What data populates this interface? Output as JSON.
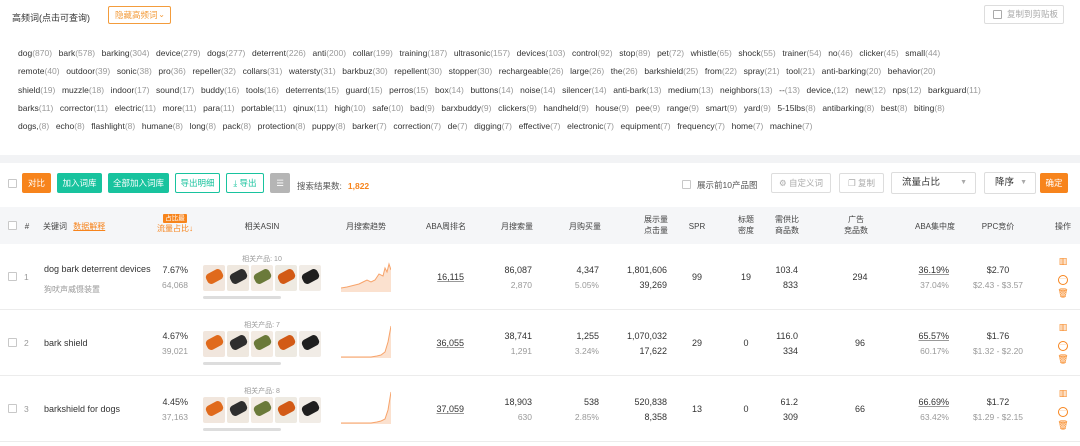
{
  "header": {
    "title": "高频词(点击可查询)",
    "hide_btn": "隐藏高频词",
    "copy_btn": "复制到剪贴板"
  },
  "keyword_lines": [
    [
      [
        "dog",
        "870"
      ],
      [
        "bark",
        "578"
      ],
      [
        "barking",
        "304"
      ],
      [
        "device",
        "279"
      ],
      [
        "dogs",
        "277"
      ],
      [
        "deterrent",
        "226"
      ],
      [
        "anti",
        "200"
      ],
      [
        "collar",
        "199"
      ],
      [
        "training",
        "187"
      ],
      [
        "ultrasonic",
        "157"
      ],
      [
        "devices",
        "103"
      ],
      [
        "control",
        "92"
      ],
      [
        "stop",
        "89"
      ],
      [
        "pet",
        "72"
      ],
      [
        "whistle",
        "65"
      ],
      [
        "shock",
        "55"
      ],
      [
        "trainer",
        "54"
      ],
      [
        "no",
        "46"
      ],
      [
        "clicker",
        "45"
      ],
      [
        "small",
        "44"
      ]
    ],
    [
      [
        "remote",
        "40"
      ],
      [
        "outdoor",
        "39"
      ],
      [
        "sonic",
        "38"
      ],
      [
        "pro",
        "36"
      ],
      [
        "repeller",
        "32"
      ],
      [
        "collars",
        "31"
      ],
      [
        "watersty",
        "31"
      ],
      [
        "barkbuz",
        "30"
      ],
      [
        "repellent",
        "30"
      ],
      [
        "stopper",
        "30"
      ],
      [
        "rechargeable",
        "26"
      ],
      [
        "large",
        "26"
      ],
      [
        "the",
        "26"
      ],
      [
        "barkshield",
        "25"
      ],
      [
        "from",
        "22"
      ],
      [
        "spray",
        "21"
      ],
      [
        "tool",
        "21"
      ],
      [
        "anti-barking",
        "20"
      ],
      [
        "behavior",
        "20"
      ]
    ],
    [
      [
        "shield",
        "19"
      ],
      [
        "muzzle",
        "18"
      ],
      [
        "indoor",
        "17"
      ],
      [
        "sound",
        "17"
      ],
      [
        "buddy",
        "16"
      ],
      [
        "tools",
        "16"
      ],
      [
        "deterrents",
        "15"
      ],
      [
        "guard",
        "15"
      ],
      [
        "perros",
        "15"
      ],
      [
        "box",
        "14"
      ],
      [
        "buttons",
        "14"
      ],
      [
        "noise",
        "14"
      ],
      [
        "silencer",
        "14"
      ],
      [
        "anti-bark",
        "13"
      ],
      [
        "medium",
        "13"
      ],
      [
        "neighbors",
        "13"
      ],
      [
        "--",
        "13"
      ],
      [
        "device,",
        "12"
      ],
      [
        "new",
        "12"
      ],
      [
        "nps",
        "12"
      ],
      [
        "barkguard",
        "11"
      ]
    ],
    [
      [
        "barks",
        "11"
      ],
      [
        "corrector",
        "11"
      ],
      [
        "electric",
        "11"
      ],
      [
        "more",
        "11"
      ],
      [
        "para",
        "11"
      ],
      [
        "portable",
        "11"
      ],
      [
        "qinux",
        "11"
      ],
      [
        "high",
        "10"
      ],
      [
        "safe",
        "10"
      ],
      [
        "bad",
        "9"
      ],
      [
        "barxbuddy",
        "9"
      ],
      [
        "clickers",
        "9"
      ],
      [
        "handheld",
        "9"
      ],
      [
        "house",
        "9"
      ],
      [
        "pee",
        "9"
      ],
      [
        "range",
        "9"
      ],
      [
        "smart",
        "9"
      ],
      [
        "yard",
        "9"
      ],
      [
        "5-15lbs",
        "8"
      ],
      [
        "antibarking",
        "8"
      ],
      [
        "best",
        "8"
      ],
      [
        "biting",
        "8"
      ]
    ],
    [
      [
        "dogs,",
        "8"
      ],
      [
        "echo",
        "8"
      ],
      [
        "flashlight",
        "8"
      ],
      [
        "humane",
        "8"
      ],
      [
        "long",
        "8"
      ],
      [
        "pack",
        "8"
      ],
      [
        "protection",
        "8"
      ],
      [
        "puppy",
        "8"
      ],
      [
        "barker",
        "7"
      ],
      [
        "correction",
        "7"
      ],
      [
        "de",
        "7"
      ],
      [
        "digging",
        "7"
      ],
      [
        "effective",
        "7"
      ],
      [
        "electronic",
        "7"
      ],
      [
        "equipment",
        "7"
      ],
      [
        "frequency",
        "7"
      ],
      [
        "home",
        "7"
      ],
      [
        "machine",
        "7"
      ]
    ]
  ],
  "toolbar": {
    "compare": "对比",
    "add_lib": "加入词库",
    "add_all": "全部加入词库",
    "export_detail": "导出明细",
    "export": "导出",
    "search_label": "搜索结果数:",
    "search_count": "1,822",
    "show_top10": "展示前10产品图",
    "custom_syn": "自定义词",
    "copy": "复制",
    "sort_field": "流量占比",
    "sort_order": "降序",
    "confirm": "确定"
  },
  "columns": {
    "idx": "#",
    "keyword": "关键词",
    "keyword_tip": "数据解释",
    "traffic_badge": "占比最",
    "traffic": "流量占比↓",
    "asin": "相关ASIN",
    "trend": "月搜索趋势",
    "aba": "ABA周排名",
    "msearch": "月搜索量",
    "mbuy": "月购买量",
    "show_click_1": "展示量",
    "show_click_2": "点击量",
    "spr": "SPR",
    "title_1": "标题",
    "title_2": "密度",
    "supply_1": "需供比",
    "supply_2": "商品数",
    "ad_1": "广告",
    "ad_2": "竞品数",
    "aba_conc": "ABA集中度",
    "ppc": "PPC竞价",
    "ops": "操作"
  },
  "rows": [
    {
      "idx": "1",
      "kw": "dog bark deterrent devices",
      "kw_cn": "狗吠声威慑装置",
      "traffic_pct": "7.67%",
      "traffic_n": "64,068",
      "related": "相关产品: 10",
      "aba": "16,115",
      "msearch": "86,087",
      "msearch_sub": "2,870",
      "mbuy": "4,347",
      "mbuy_sub": "5.05%",
      "show": "1,801,606",
      "click": "39,269",
      "spr": "99",
      "title_density": "19",
      "supply": "103.4",
      "goods": "833",
      "ad": "294",
      "conc": "36.19%",
      "conc_sub": "37.04%",
      "ppc": "$2.70",
      "ppc_range": "$2.43 - $3.57"
    },
    {
      "idx": "2",
      "kw": "bark shield",
      "kw_cn": "",
      "traffic_pct": "4.67%",
      "traffic_n": "39,021",
      "related": "相关产品: 7",
      "aba": "36,055",
      "msearch": "38,741",
      "msearch_sub": "1,291",
      "mbuy": "1,255",
      "mbuy_sub": "3.24%",
      "show": "1,070,032",
      "click": "17,622",
      "spr": "29",
      "title_density": "0",
      "supply": "116.0",
      "goods": "334",
      "ad": "96",
      "conc": "65.57%",
      "conc_sub": "60.17%",
      "ppc": "$1.76",
      "ppc_range": "$1.32 - $2.20"
    },
    {
      "idx": "3",
      "kw": "barkshield for dogs",
      "kw_cn": "",
      "traffic_pct": "4.45%",
      "traffic_n": "37,163",
      "related": "相关产品: 8",
      "aba": "37,059",
      "msearch": "18,903",
      "msearch_sub": "630",
      "mbuy": "538",
      "mbuy_sub": "2.85%",
      "show": "520,838",
      "click": "8,358",
      "spr": "13",
      "title_density": "0",
      "supply": "61.2",
      "goods": "309",
      "ad": "66",
      "conc": "66.69%",
      "conc_sub": "63.42%",
      "ppc": "$1.72",
      "ppc_range": "$1.29 - $2.15"
    }
  ],
  "colors": {
    "accent": "#f7841c",
    "teal": "#18c39e",
    "trend": "#f7a36a"
  }
}
